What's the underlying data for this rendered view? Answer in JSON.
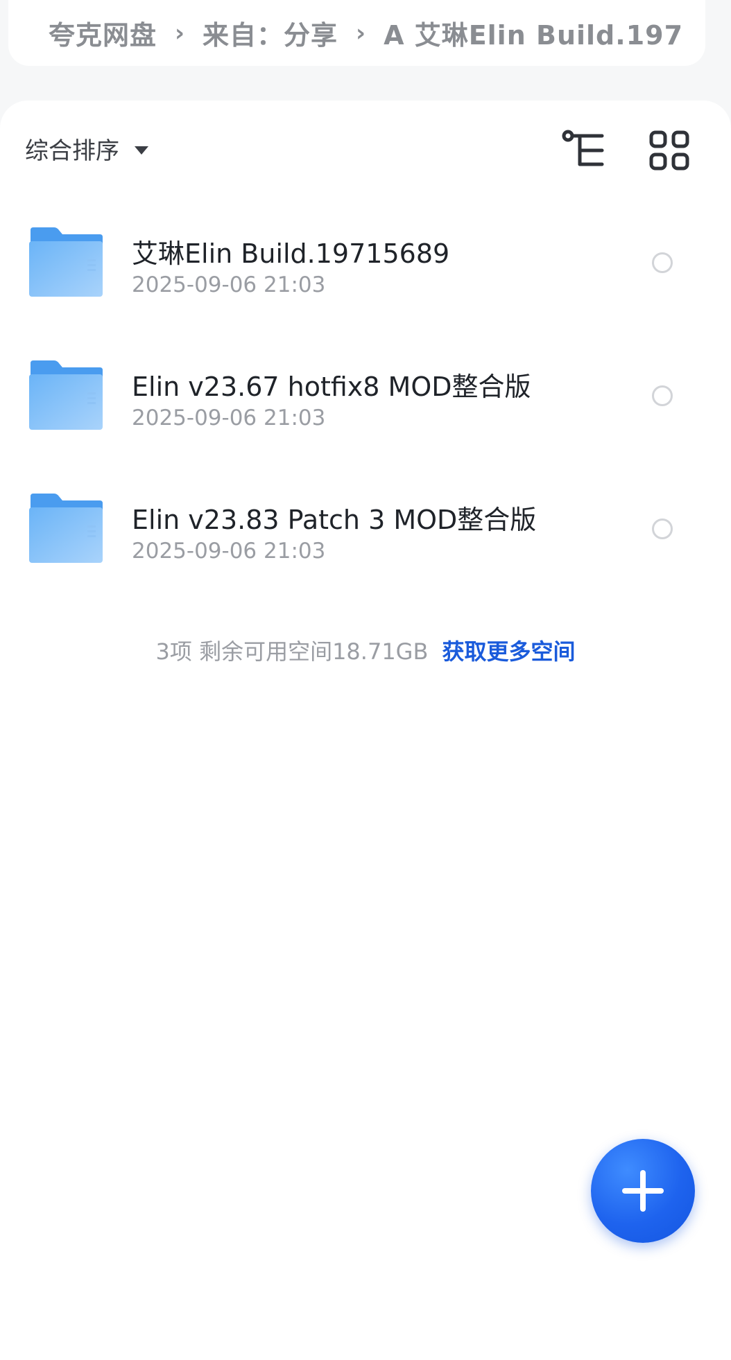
{
  "breadcrumb": {
    "items": [
      "夸克网盘",
      "来自：分享",
      "A 艾琳Elin Build.197"
    ],
    "separator": "›"
  },
  "toolbar": {
    "sort_label": "综合排序",
    "tree_view_icon": "tree-view-icon",
    "grid_view_icon": "grid-view-icon"
  },
  "files": [
    {
      "name": "艾琳Elin Build.19715689",
      "date": "2025-09-06 21:03",
      "icon": "folder-icon"
    },
    {
      "name": "Elin v23.67 hotfix8 MOD整合版",
      "date": "2025-09-06 21:03",
      "icon": "folder-icon"
    },
    {
      "name": "Elin v23.83 Patch 3 MOD整合版",
      "date": "2025-09-06 21:03",
      "icon": "folder-icon"
    }
  ],
  "summary": {
    "count_text": "3项 剩余可用空间18.71GB",
    "link_text": "获取更多空间"
  },
  "fab": {
    "icon": "plus-icon"
  },
  "colors": {
    "accent": "#1a5bdb",
    "fab": "#1e63ee",
    "folder": "#5aa7f2",
    "background": "#f6f7f8"
  }
}
